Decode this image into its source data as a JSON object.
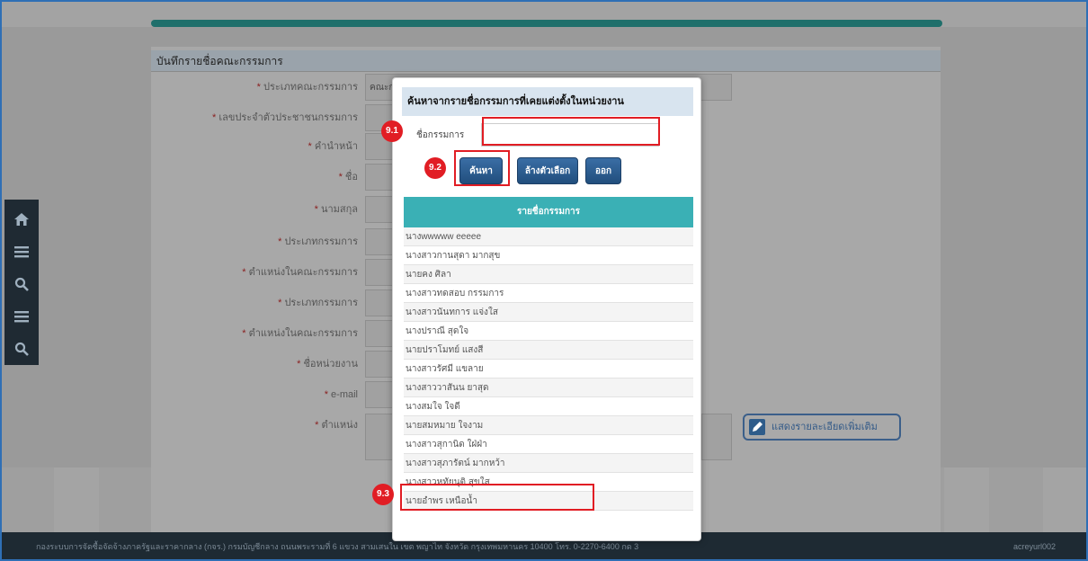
{
  "form": {
    "header": "บันทึกรายชื่อคณะกรรมการ",
    "fields": [
      {
        "label": "ประเภทคณะกรรมการ",
        "value": "คณะก"
      },
      {
        "label": "เลขประจำตัวประชาชนกรรมการ",
        "value": ""
      },
      {
        "label": "คำนำหน้า",
        "value": ""
      },
      {
        "label": "ชื่อ",
        "value": ""
      },
      {
        "label": "นามสกุล",
        "value": ""
      },
      {
        "label": "ประเภทกรรมการ",
        "value": ""
      },
      {
        "label": "ตำแหน่งในคณะกรรมการ",
        "value": ""
      },
      {
        "label": "ประเภทกรรมการ",
        "value": ""
      },
      {
        "label": "ตำแหน่งในคณะกรรมการ",
        "value": ""
      },
      {
        "label": "ชื่อหน่วยงาน",
        "value": ""
      },
      {
        "label": "e-mail",
        "value": ""
      },
      {
        "label": "ตำแหน่ง",
        "value": ""
      }
    ],
    "details_button": "แสดงรายละเอียดเพิ่มเติม"
  },
  "modal": {
    "title": "ค้นหาจากรายชื่อกรรมการที่เคยแต่งตั้งในหน่วยงาน",
    "name_label": "ชื่อกรรมการ",
    "name_value": "",
    "buttons": {
      "search": "ค้นหา",
      "clear": "ล้างตัวเลือก",
      "exit": "ออก"
    },
    "list_header": "รายชื่อกรรมการ",
    "list": [
      "นางwwwww eeeee",
      "นางสาวกานสุดา มากสุข",
      "นายคง ศิลา",
      "นางสาวทดสอบ กรรมการ",
      "นางสาวนันทการ แจ่งใส",
      "นางปราณี สุดใจ",
      "นายปราโมทย์ แสงสี",
      "นางสาวรัศมี แขลาย",
      "นางสาววาสันน ยาสุด",
      "นางสมใจ ใจดี",
      "นายสมหมาย ใจงาม",
      "นางสาวสุกานิด ใฝ่ฝ่า",
      "นางสาวสุภารัตน์ มากหว้า",
      "นางสาวหทัยนุติ สุขใส",
      "นายอำพร เหนือน้ำ"
    ]
  },
  "annotations": {
    "step1": "9.1",
    "step2": "9.2",
    "step3": "9.3"
  },
  "footer": {
    "left": "กองระบบการจัดซื้อจัดจ้างภาครัฐและราคากลาง (กจร.) กรมบัญชีกลาง ถนนพระรามที่ 6 แขวง สามเสนใน เขต พญาไท จังหวัด กรุงเทพมหานคร 10400 โทร. 0-2270-6400 กด 3",
    "right": "acreyurl002"
  },
  "colors": {
    "teal": "#3ab0b5",
    "button_blue": "#2b5a8c",
    "highlight_red": "#e11d24",
    "footer": "#1e2a33"
  }
}
